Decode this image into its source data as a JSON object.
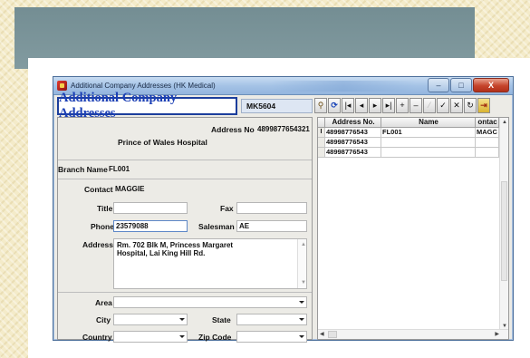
{
  "window": {
    "title": "Additional Company Addresses (HK Medical)",
    "min_glyph": "–",
    "max_glyph": "□",
    "close_glyph": "X"
  },
  "toolbar": {
    "caption": "Additional Company Addresses",
    "code": "MK5604",
    "buttons": [
      {
        "name": "search",
        "glyph": "⚲"
      },
      {
        "name": "refresh",
        "glyph": "⟳"
      },
      {
        "name": "first",
        "glyph": "|◂"
      },
      {
        "name": "prev",
        "glyph": "◂"
      },
      {
        "name": "next",
        "glyph": "▸"
      },
      {
        "name": "last",
        "glyph": "▸|"
      },
      {
        "name": "insert",
        "glyph": "+"
      },
      {
        "name": "delete",
        "glyph": "–"
      },
      {
        "name": "edit",
        "glyph": "⁄"
      },
      {
        "name": "post",
        "glyph": "✓"
      },
      {
        "name": "cancel",
        "glyph": "✕"
      },
      {
        "name": "refresh-data",
        "glyph": "↻"
      },
      {
        "name": "exit",
        "glyph": "⇥"
      }
    ]
  },
  "form": {
    "address_no_label": "Address No",
    "address_no": "4899877654321",
    "company": "Prince of Wales Hospital",
    "branch_name_label": "Branch Name",
    "branch_name": "FL001",
    "contact_label": "Contact",
    "contact": "MAGGIE",
    "title_label": "Title",
    "title": "",
    "fax_label": "Fax",
    "fax": "",
    "phone_label": "Phone",
    "phone": "23579088",
    "salesman_label": "Salesman",
    "salesman": "AE",
    "address_label": "Address",
    "address_line1": "Rm. 702 Blk M, Princess Margaret",
    "address_line2": "Hospital, Lai King Hill Rd.",
    "area_label": "Area",
    "area": "",
    "city_label": "City",
    "city": "",
    "state_label": "State",
    "state": "",
    "country_label": "Country",
    "country": "",
    "zip_label": "Zip Code",
    "zip": ""
  },
  "grid": {
    "columns": [
      "Address No.",
      "Name",
      "ontac"
    ],
    "rows": [
      {
        "indicator": "I",
        "address_no": "48998776543",
        "name": "FL001",
        "contact": "MAGC"
      },
      {
        "indicator": "",
        "address_no": "48998776543",
        "name": "",
        "contact": ""
      },
      {
        "indicator": "",
        "address_no": "48998776543",
        "name": "",
        "contact": ""
      }
    ]
  }
}
